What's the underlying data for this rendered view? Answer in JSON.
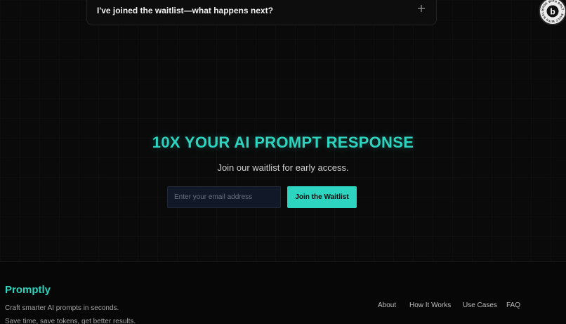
{
  "faq": {
    "question": "I've joined the waitlist—what happens next?",
    "toggle_icon": "plus-icon"
  },
  "badge": {
    "letter": "b",
    "ring_text": "MADE WITH BOLT · BUILT WITH BOLT · "
  },
  "hero": {
    "headline": "10X YOUR AI PROMPT RESPONSE",
    "subhead": "Join our waitlist for early access.",
    "email_placeholder": "Enter your email address",
    "email_value": "",
    "join_label": "Join the Waitlist"
  },
  "footer": {
    "brand": "Promptly",
    "tagline": "Craft smarter AI prompts in seconds.",
    "subline": "Save time, save tokens, get better results.",
    "nav": [
      {
        "label": "About"
      },
      {
        "label": "How It Works"
      },
      {
        "label": "Use Cases"
      },
      {
        "label": "FAQ"
      }
    ]
  },
  "colors": {
    "accent": "#2dd4bf",
    "background": "#0a0a0a",
    "footer_background": "#070707",
    "input_background": "#111827"
  }
}
